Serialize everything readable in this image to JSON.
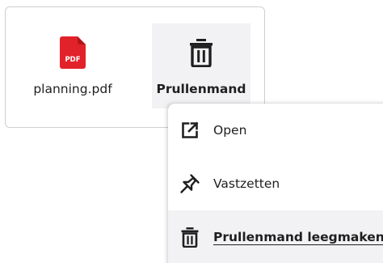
{
  "desktop": {
    "items": [
      {
        "label": "planning.pdf",
        "icon": "pdf-file-icon",
        "badge": "PDF",
        "icon_color": "#e2222a"
      },
      {
        "label": "Prullenmand",
        "icon": "trash-icon",
        "selected": true
      }
    ]
  },
  "context_menu": {
    "items": [
      {
        "label": "Open",
        "icon": "open-external-icon"
      },
      {
        "label": "Vastzetten",
        "icon": "pin-icon"
      },
      {
        "label": "Prullenmand leegmaken",
        "icon": "trash-icon",
        "highlighted": true
      }
    ]
  },
  "colors": {
    "selection_background": "#f2f2f4",
    "pdf_red": "#e2222a",
    "text": "#1f1f1f",
    "border": "#cfcfcf"
  }
}
